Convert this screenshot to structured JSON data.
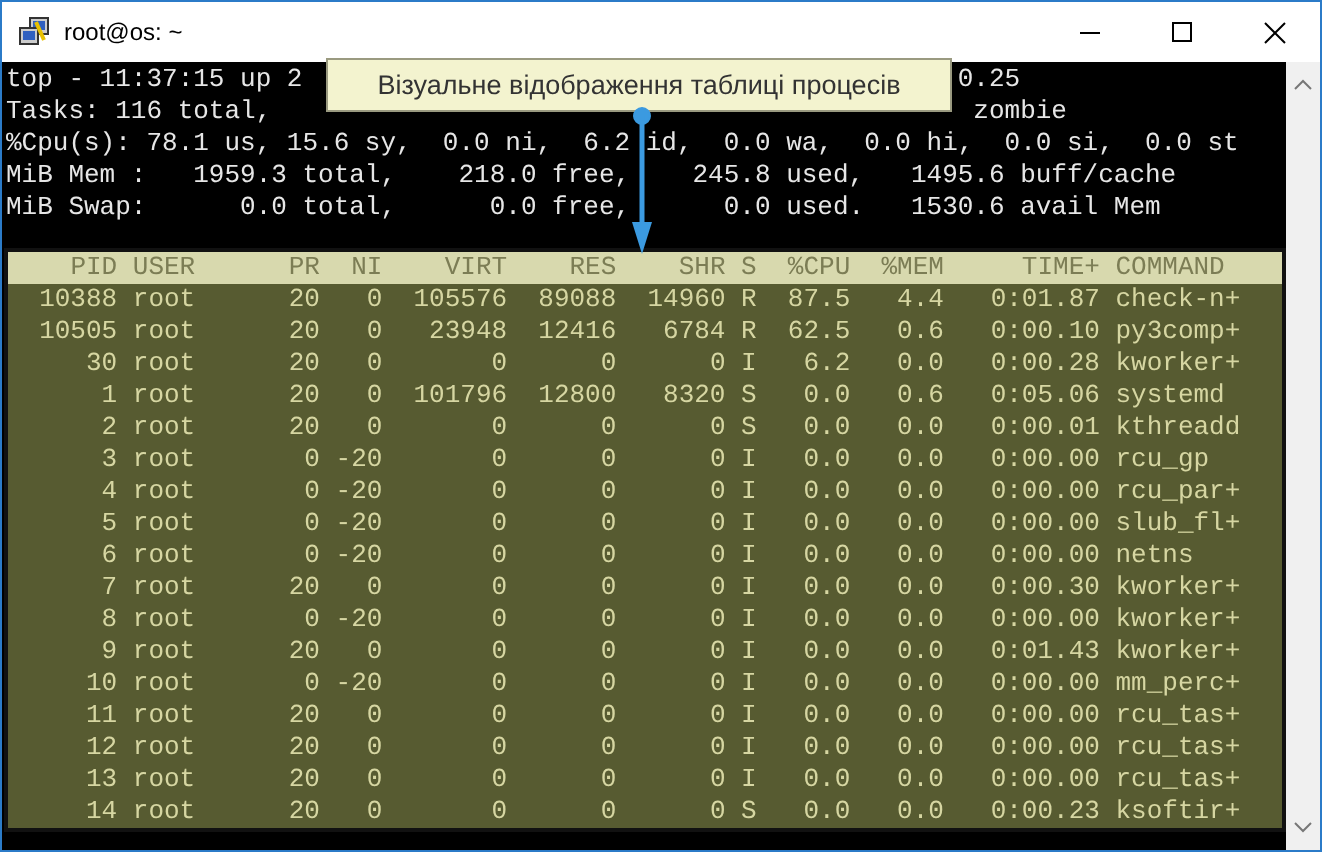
{
  "window": {
    "title": "root@os: ~"
  },
  "summary_lines": [
    {
      "segments": [
        "top - 11:37:15 up 2",
        "0.25"
      ]
    },
    {
      "segments": [
        "Tasks: 116 total,",
        "zombie"
      ]
    },
    {
      "segments": [
        "%Cpu(s): 78.1 us, 15.6 sy,  0.0 ni,  6.2 id,  0.0 wa,  0.0 hi,  0.0 si,  0.0 st"
      ]
    },
    {
      "segments": [
        "MiB Mem :   1959.3 total,    218.0 free,    245.8 used,   1495.6 buff/cache"
      ]
    },
    {
      "segments": [
        "MiB Swap:      0.0 total,      0.0 free,      0.0 used.   1530.6 avail Mem"
      ]
    }
  ],
  "tooltip": {
    "text": "Візуальне відображення таблиці процесів"
  },
  "table": {
    "columns": [
      "PID",
      "USER",
      "PR",
      "NI",
      "VIRT",
      "RES",
      "SHR",
      "S",
      "%CPU",
      "%MEM",
      "TIME+",
      "COMMAND"
    ],
    "rows": [
      [
        "10388",
        "root",
        "20",
        "0",
        "105576",
        "89088",
        "14960",
        "R",
        "87.5",
        "4.4",
        "0:01.87",
        "check-n+"
      ],
      [
        "10505",
        "root",
        "20",
        "0",
        "23948",
        "12416",
        "6784",
        "R",
        "62.5",
        "0.6",
        "0:00.10",
        "py3comp+"
      ],
      [
        "30",
        "root",
        "20",
        "0",
        "0",
        "0",
        "0",
        "I",
        "6.2",
        "0.0",
        "0:00.28",
        "kworker+"
      ],
      [
        "1",
        "root",
        "20",
        "0",
        "101796",
        "12800",
        "8320",
        "S",
        "0.0",
        "0.6",
        "0:05.06",
        "systemd"
      ],
      [
        "2",
        "root",
        "20",
        "0",
        "0",
        "0",
        "0",
        "S",
        "0.0",
        "0.0",
        "0:00.01",
        "kthreadd"
      ],
      [
        "3",
        "root",
        "0",
        "-20",
        "0",
        "0",
        "0",
        "I",
        "0.0",
        "0.0",
        "0:00.00",
        "rcu_gp"
      ],
      [
        "4",
        "root",
        "0",
        "-20",
        "0",
        "0",
        "0",
        "I",
        "0.0",
        "0.0",
        "0:00.00",
        "rcu_par+"
      ],
      [
        "5",
        "root",
        "0",
        "-20",
        "0",
        "0",
        "0",
        "I",
        "0.0",
        "0.0",
        "0:00.00",
        "slub_fl+"
      ],
      [
        "6",
        "root",
        "0",
        "-20",
        "0",
        "0",
        "0",
        "I",
        "0.0",
        "0.0",
        "0:00.00",
        "netns"
      ],
      [
        "7",
        "root",
        "20",
        "0",
        "0",
        "0",
        "0",
        "I",
        "0.0",
        "0.0",
        "0:00.30",
        "kworker+"
      ],
      [
        "8",
        "root",
        "0",
        "-20",
        "0",
        "0",
        "0",
        "I",
        "0.0",
        "0.0",
        "0:00.00",
        "kworker+"
      ],
      [
        "9",
        "root",
        "20",
        "0",
        "0",
        "0",
        "0",
        "I",
        "0.0",
        "0.0",
        "0:01.43",
        "kworker+"
      ],
      [
        "10",
        "root",
        "0",
        "-20",
        "0",
        "0",
        "0",
        "I",
        "0.0",
        "0.0",
        "0:00.00",
        "mm_perc+"
      ],
      [
        "11",
        "root",
        "20",
        "0",
        "0",
        "0",
        "0",
        "I",
        "0.0",
        "0.0",
        "0:00.00",
        "rcu_tas+"
      ],
      [
        "12",
        "root",
        "20",
        "0",
        "0",
        "0",
        "0",
        "I",
        "0.0",
        "0.0",
        "0:00.00",
        "rcu_tas+"
      ],
      [
        "13",
        "root",
        "20",
        "0",
        "0",
        "0",
        "0",
        "I",
        "0.0",
        "0.0",
        "0:00.00",
        "rcu_tas+"
      ],
      [
        "14",
        "root",
        "20",
        "0",
        "0",
        "0",
        "0",
        "S",
        "0.0",
        "0.0",
        "0:00.23",
        "ksoftir+"
      ]
    ]
  }
}
